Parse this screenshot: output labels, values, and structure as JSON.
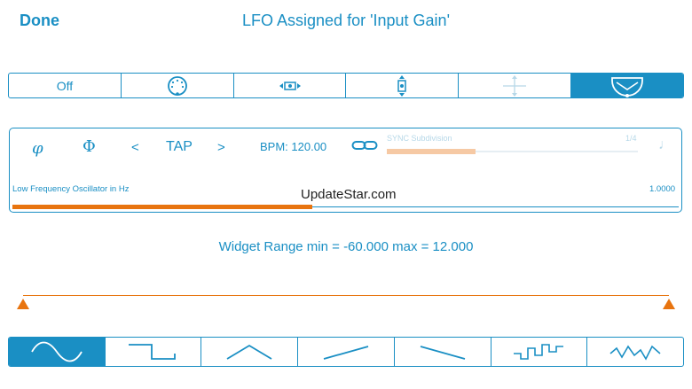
{
  "header": {
    "done_label": "Done",
    "title": "LFO Assigned for 'Input Gain'"
  },
  "modes": {
    "items": [
      {
        "label": "Off",
        "icon": "off"
      },
      {
        "label": "",
        "icon": "dial-icon"
      },
      {
        "label": "",
        "icon": "horizontal-move-icon"
      },
      {
        "label": "",
        "icon": "vertical-move-icon"
      },
      {
        "label": "",
        "icon": "xy-move-icon"
      },
      {
        "label": "",
        "icon": "arc-dial-icon"
      }
    ],
    "active_index": 5
  },
  "lfo": {
    "phase_reset_symbol": "φ",
    "phase_symbol": "Φ",
    "prev_label": "<",
    "tap_label": "TAP",
    "next_label": ">",
    "bpm_text": "BPM: 120.00",
    "sync_label": "SYNC Subdivision",
    "sync_value": "1/4",
    "note_symbol": "♩",
    "freq_label": "Low Frequency Oscillator in Hz",
    "freq_value": "1.0000",
    "freq_fraction": 0.45
  },
  "watermark": "UpdateStar.com",
  "range_text": "Widget Range min = -60.000 max = 12.000",
  "waveforms": {
    "items": [
      "sine-wave-icon",
      "square-wave-icon",
      "triangle-wave-icon",
      "ramp-up-icon",
      "ramp-down-icon",
      "random-steps-icon",
      "random-smooth-icon"
    ],
    "active_index": 0
  },
  "colors": {
    "accent": "#1a8fc4",
    "orange": "#e8740f",
    "disabled": "#b7d8e8"
  }
}
